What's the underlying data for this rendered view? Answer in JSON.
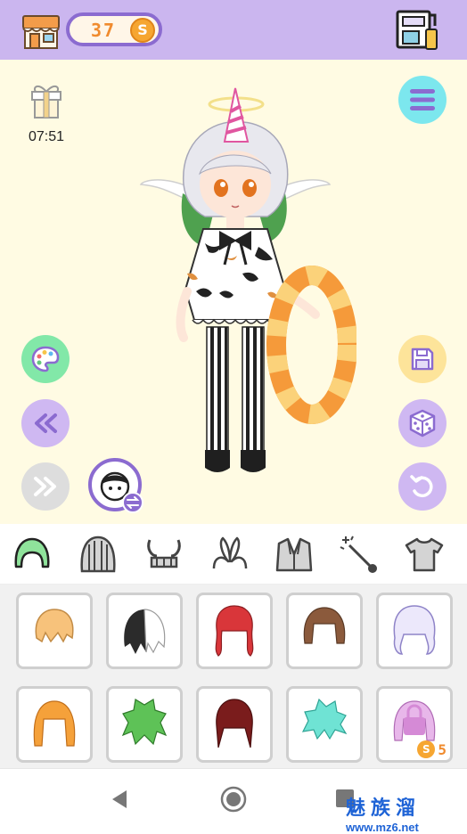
{
  "topbar": {
    "coins": "37",
    "coin_symbol": "S",
    "icons": [
      "shop-icon",
      "dressing-machine-icon"
    ]
  },
  "stage": {
    "timer": "07:51",
    "icons": [
      "gift-icon",
      "menu-icon",
      "palette-icon",
      "previous-icon",
      "next-icon",
      "face-swap-icon",
      "save-icon",
      "dice-icon",
      "undo-icon"
    ]
  },
  "categories": [
    {
      "id": "hair",
      "icon": "hair-icon",
      "selected": true
    },
    {
      "id": "back-hair",
      "icon": "back-hair-icon"
    },
    {
      "id": "horns",
      "icon": "horns-icon"
    },
    {
      "id": "ears",
      "icon": "bunny-ears-icon"
    },
    {
      "id": "jacket",
      "icon": "jacket-icon"
    },
    {
      "id": "wand",
      "icon": "magic-wand-icon"
    },
    {
      "id": "shirt",
      "icon": "shirt-icon"
    }
  ],
  "hair_items": [
    {
      "color": "#f7c27b",
      "style": "short"
    },
    {
      "color": "#2b2b2b",
      "style": "split"
    },
    {
      "color": "#d9363a",
      "style": "long"
    },
    {
      "color": "#8b5a3c",
      "style": "bob"
    },
    {
      "color": "#c9c2f0",
      "style": "curly"
    },
    {
      "color": "#f5a13a",
      "style": "bob"
    },
    {
      "color": "#5ec257",
      "style": "spiky"
    },
    {
      "color": "#7a1c1c",
      "style": "long"
    },
    {
      "color": "#6fe3d4",
      "style": "spiky"
    },
    {
      "color": "#d58ad6",
      "style": "locked",
      "price": "5",
      "price_symbol": "S"
    }
  ],
  "colors": {
    "topbar": "#cbb6ef",
    "stage": "#fffbe3",
    "accent_purple": "#8b6bd0",
    "coin": "#f6a631"
  },
  "watermark": {
    "cn": "魅族溜",
    "url": "www.mz6.net"
  }
}
